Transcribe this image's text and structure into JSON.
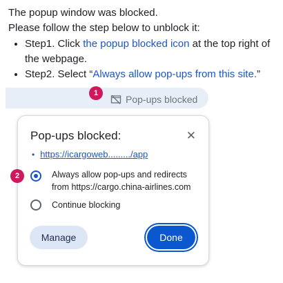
{
  "intro": {
    "line1": "The popup window was blocked.",
    "line2": "Please follow the step below to unblock it:",
    "step1_prefix": "Step1. Click ",
    "step1_link": "the popup blocked icon",
    "step1_suffix": " at the top right of the webpage.",
    "step2_prefix": "Step2. Select “",
    "step2_link": "Always allow pop-ups from this site.",
    "step2_suffix": "”"
  },
  "toolbar": {
    "blocked_label": "Pop-ups blocked",
    "blocked_icon": "popup-blocked-icon"
  },
  "markers": {
    "m1": "1",
    "m2": "2"
  },
  "dialog": {
    "title": "Pop-ups blocked:",
    "close_icon": "close-icon",
    "blocked_url": "https://icargoweb........./app",
    "options": [
      {
        "label": "Always allow pop-ups and redirects from https://cargo.china-airlines.com",
        "checked": true
      },
      {
        "label": "Continue blocking",
        "checked": false
      }
    ],
    "manage_label": "Manage",
    "done_label": "Done"
  },
  "colors": {
    "accent": "#0b57d0",
    "link": "#1a55c9",
    "marker": "#cc1a5c",
    "address_bar": "#e8eef7",
    "manage_button": "#dce6f7"
  }
}
